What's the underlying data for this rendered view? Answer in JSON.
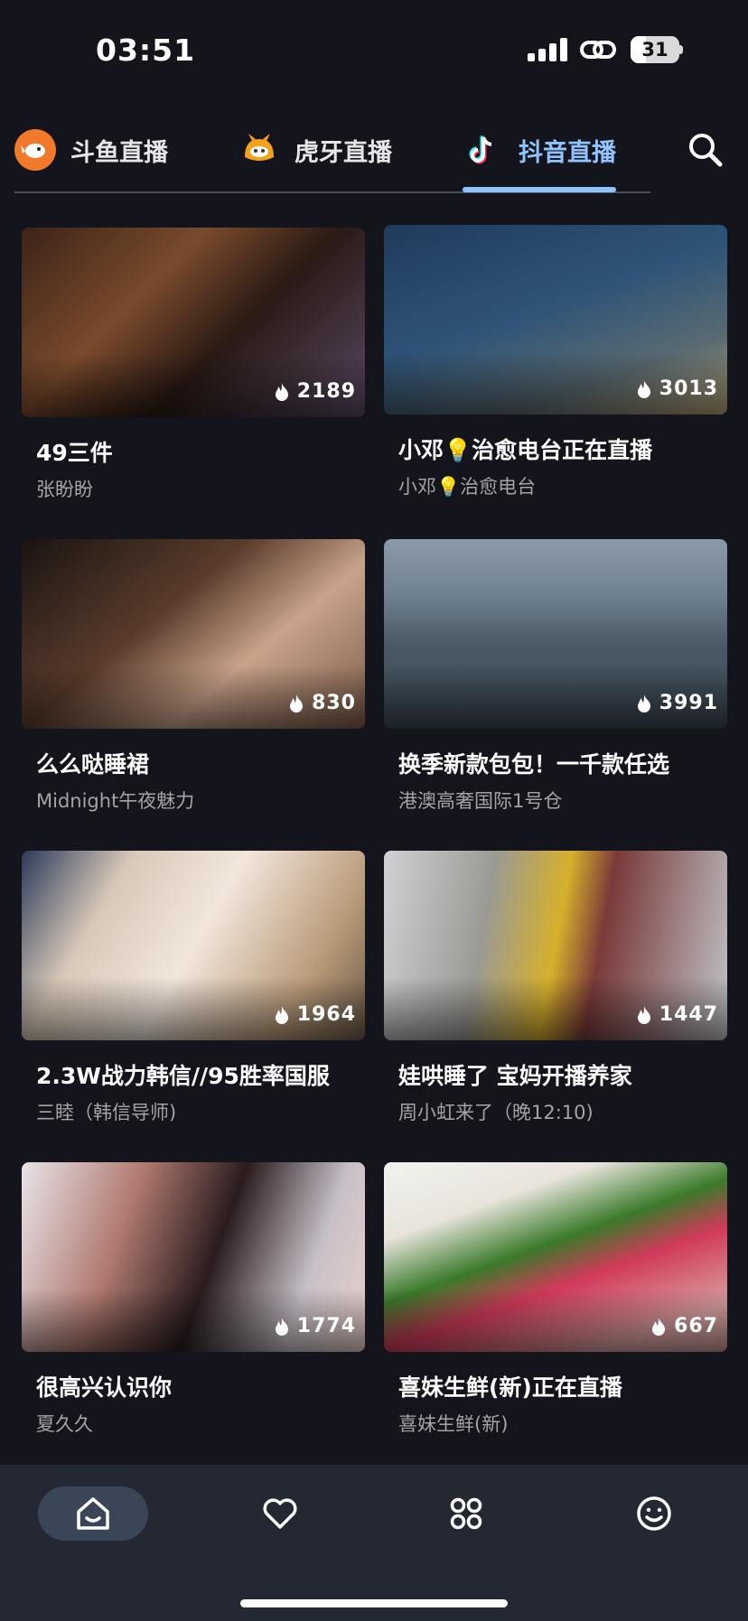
{
  "status_bar": {
    "time": "03:51",
    "battery": "31"
  },
  "tabs": [
    {
      "label": "斗鱼直播",
      "icon": "douyu-logo-icon",
      "active": false
    },
    {
      "label": "虎牙直播",
      "icon": "huya-logo-icon",
      "active": false
    },
    {
      "label": "抖音直播",
      "icon": "douyin-logo-icon",
      "active": true
    }
  ],
  "search": {
    "icon": "search-icon"
  },
  "streams": [
    {
      "title": "49三件",
      "streamer": "张盼盼",
      "viewers": "2189"
    },
    {
      "title": "小邓💡治愈电台正在直播",
      "streamer": "小邓💡治愈电台",
      "viewers": "3013"
    },
    {
      "title": "么么哒睡裙",
      "streamer": "Midnight午夜魅力",
      "viewers": "830"
    },
    {
      "title": "换季新款包包！一千款任选",
      "streamer": "港澳高奢国际1号仓",
      "viewers": "3991"
    },
    {
      "title": "2.3W战力韩信//95胜率国服",
      "streamer": "三睦（韩信导师)",
      "viewers": "1964"
    },
    {
      "title": "娃哄睡了 宝妈开播养家",
      "streamer": "周小虹来了（晚12:10)",
      "viewers": "1447"
    },
    {
      "title": "很高兴认识你",
      "streamer": "夏久久",
      "viewers": "1774"
    },
    {
      "title": "喜妹生鲜(新)正在直播",
      "streamer": "喜妹生鲜(新)",
      "viewers": "667"
    }
  ],
  "bottom_nav": [
    {
      "icon": "home-icon",
      "active": true
    },
    {
      "icon": "heart-icon",
      "active": false
    },
    {
      "icon": "grid-icon",
      "active": false
    },
    {
      "icon": "smiley-icon",
      "active": false
    }
  ],
  "colors": {
    "accent": "#8fc4ff",
    "background": "#14141c",
    "nav_bg": "#232833"
  }
}
